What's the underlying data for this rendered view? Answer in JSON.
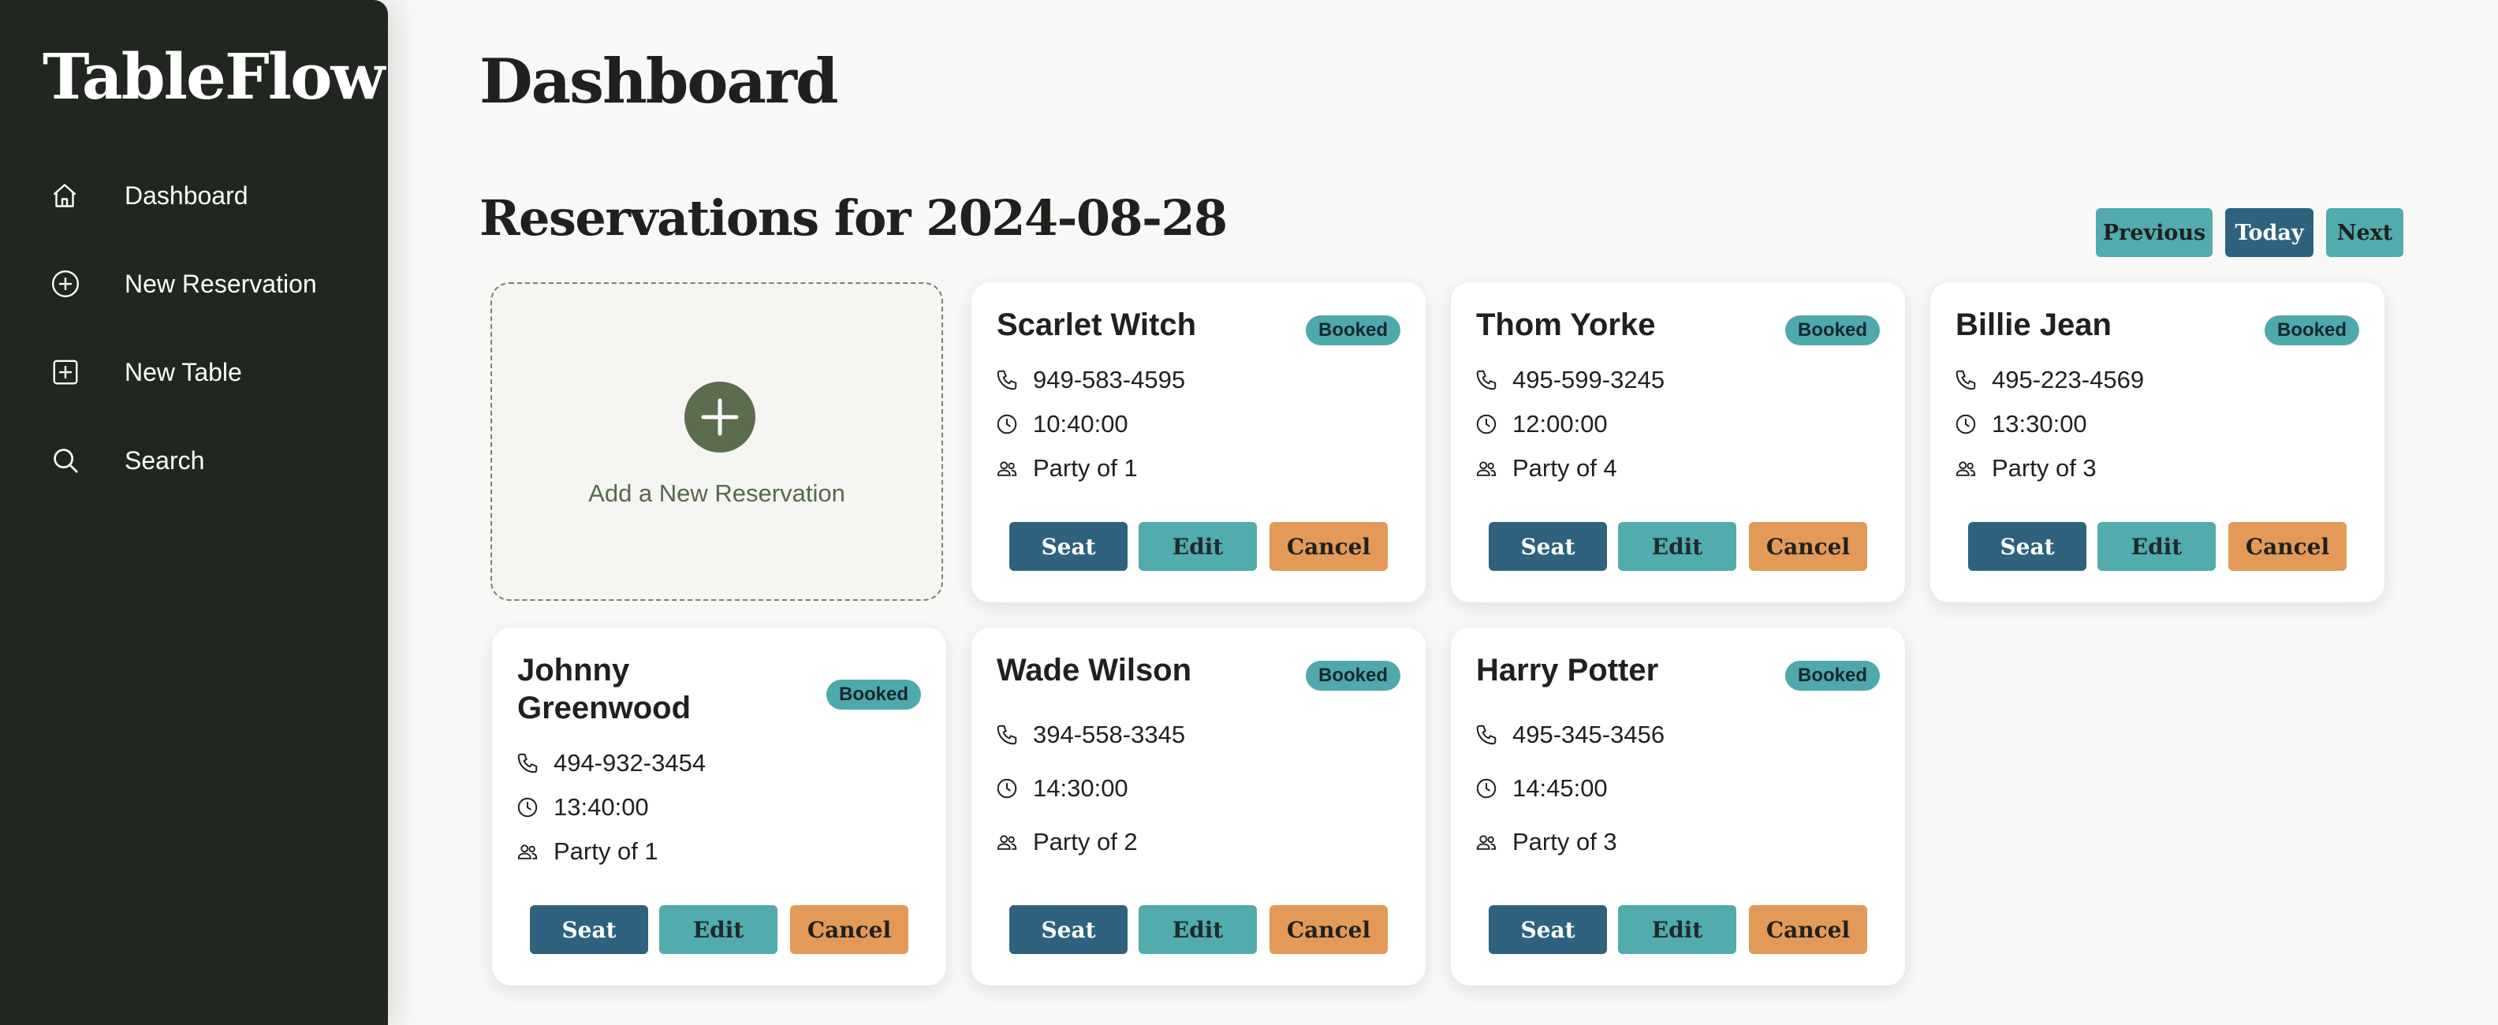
{
  "app": {
    "brand": "TableFlow"
  },
  "sidebar": {
    "items": [
      {
        "label": "Dashboard",
        "icon": "home-icon"
      },
      {
        "label": "New Reservation",
        "icon": "plus-circle-icon"
      },
      {
        "label": "New Table",
        "icon": "plus-square-icon"
      },
      {
        "label": "Search",
        "icon": "search-icon"
      }
    ]
  },
  "main": {
    "title": "Dashboard",
    "section_title": "Reservations for 2024-08-28",
    "date_nav": {
      "previous": "Previous",
      "today": "Today",
      "next": "Next"
    },
    "add_card": {
      "label": "Add a New Reservation"
    },
    "reservations": [
      {
        "name": "Scarlet Witch",
        "status": "Booked",
        "phone": "949-583-4595",
        "time": "10:40:00",
        "party": "Party of 1"
      },
      {
        "name": "Thom Yorke",
        "status": "Booked",
        "phone": "495-599-3245",
        "time": "12:00:00",
        "party": "Party of 4"
      },
      {
        "name": "Billie Jean",
        "status": "Booked",
        "phone": "495-223-4569",
        "time": "13:30:00",
        "party": "Party of 3"
      },
      {
        "name": "Johnny Greenwood",
        "status": "Booked",
        "phone": "494-932-3454",
        "time": "13:40:00",
        "party": "Party of 1"
      },
      {
        "name": "Wade Wilson",
        "status": "Booked",
        "phone": "394-558-3345",
        "time": "14:30:00",
        "party": "Party of 2"
      },
      {
        "name": "Harry Potter",
        "status": "Booked",
        "phone": "495-345-3456",
        "time": "14:45:00",
        "party": "Party of 3"
      }
    ],
    "actions": {
      "seat": "Seat",
      "edit": "Edit",
      "cancel": "Cancel"
    }
  },
  "colors": {
    "sidebar_bg": "#212620",
    "page_bg": "#f8f8f6",
    "seat": "#2e627e",
    "edit": "#52abad",
    "cancel": "#e39a58",
    "badge": "#4ea9ad",
    "add_accent": "#5b6c4f"
  }
}
